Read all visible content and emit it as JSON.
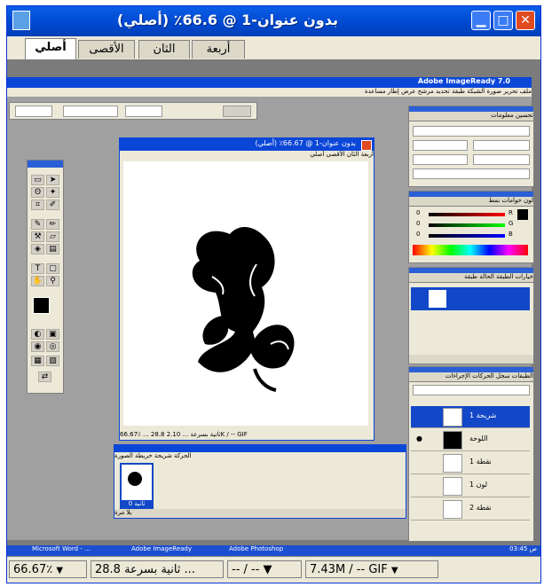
{
  "window": {
    "title": "بدون عنوان-1 @ 66.6٪ (أصلي)",
    "icons": [
      "app-icon",
      "minimize-icon",
      "maximize-icon",
      "close-icon"
    ]
  },
  "view_tabs": [
    "أربعة",
    "الثان",
    "الأقصى",
    "أصلي"
  ],
  "active_tab": "أصلي",
  "app": {
    "title": "Adobe ImageReady 7.0",
    "menu": "ملف  تحرير  صورة  الشبكة  طبقة  تحديد  مرشح  عرض  إطار  مساعدة"
  },
  "document": {
    "title": "بدون عنوان-1 @ 66.67٪ (أصلي)",
    "tabs": "أربعة  الثان  الأقصى  أصلي",
    "status": "66.67٪  ...  28.8 ثانية بسرعة  ...  2.10K / -- GIF"
  },
  "animation": {
    "tabs": "الحركة  شريحة  خريطة الصورة",
    "frame_time": "0 ثانية",
    "frame_label": "بلا مرة"
  },
  "layers_panel": {
    "tabs": "الطبقات  سجل الحركات  الإجراءات",
    "rows": [
      "شريحة 1",
      "اللوحة",
      "نقطة 1",
      "لون 1",
      "نقطة 2"
    ]
  },
  "color_panel": {
    "labels": [
      "R",
      "G",
      "B"
    ],
    "values": [
      "0",
      "0",
      "0"
    ]
  },
  "taskbar": {
    "items": [
      "Microsoft Word - ...",
      "Adobe ImageReady",
      "Adobe Photoshop"
    ],
    "clock": "03:45 ص"
  },
  "statusbar": {
    "zoom": "66.67٪",
    "download": "28.8 ثانية بسرعة ...",
    "dimensions": "-- / -- ▼",
    "filesize": "7.43M / -- GIF"
  }
}
